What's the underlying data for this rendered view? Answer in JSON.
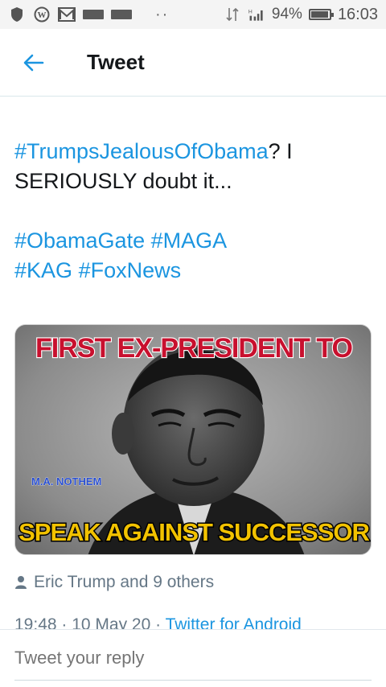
{
  "status_bar": {
    "battery": "94%",
    "time": "16:03",
    "network": "H",
    "battery_level": 0.94
  },
  "header": {
    "title": "Tweet",
    "back_icon": "arrow-left-icon"
  },
  "tweet": {
    "line1": {
      "hashtag": "#TrumpsJealousOfObama",
      "text": "? I"
    },
    "line2": "SERIOUSLY doubt it...",
    "hashtags_line3": [
      "#ObamaGate",
      "#MAGA"
    ],
    "hashtags_line4": [
      "#KAG",
      "#FoxNews"
    ]
  },
  "image": {
    "top_text": "FIRST EX-PRESIDENT TO",
    "bottom_text": "SPEAK AGAINST SUCCESSOR",
    "credit": "M.A. NOTHEM"
  },
  "engagement": {
    "liked_by": "Eric Trump and 9 others"
  },
  "meta": {
    "time": "19:48",
    "sep1": " · ",
    "date": "10 May 20",
    "sep2": " · ",
    "source": "Twitter for Android"
  },
  "reply": {
    "placeholder": "Tweet your reply"
  },
  "colors": {
    "link": "#1b95e0",
    "muted": "#657786",
    "banner_red": "#c8102e",
    "banner_yellow": "#f2c200"
  }
}
